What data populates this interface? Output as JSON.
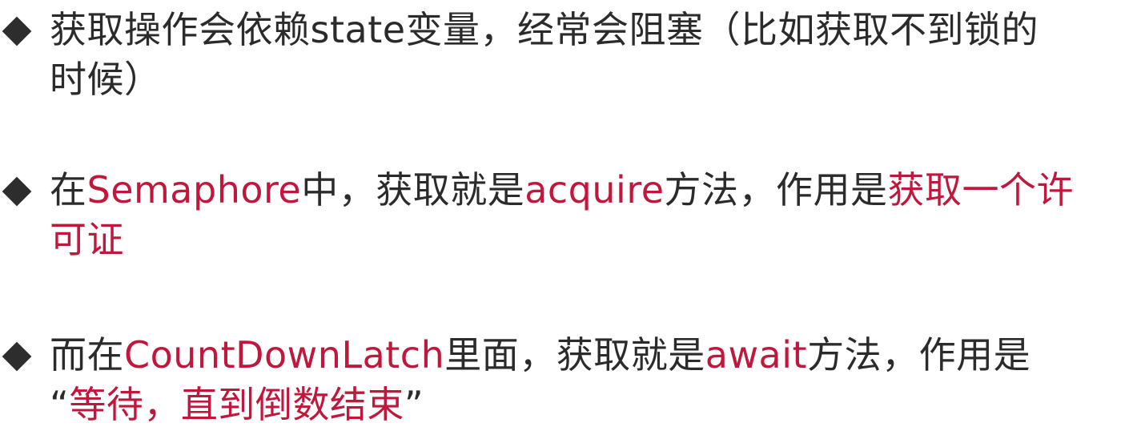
{
  "colors": {
    "text": "#2b2b2b",
    "highlight": "#c0183d",
    "bullet": "#2d2d2d"
  },
  "bullets": [
    {
      "icon": "diamond-bullet-icon",
      "line1": "获取操作会依赖state变量，经常会阻塞（比如获取不到锁的",
      "line2": "时候）"
    },
    {
      "icon": "diamond-bullet-icon",
      "t1": "在",
      "h1": "Semaphore",
      "t2": "中，获取就是",
      "h2": "acquire",
      "t3": "方法，作用是",
      "h3": "获取一个许",
      "h4": "可证"
    },
    {
      "icon": "diamond-bullet-icon",
      "t1": "而在",
      "h1": "CountDownLatch",
      "t2": "里面，获取就是",
      "h2": "await",
      "t3": "方法，作用是",
      "q_open": "“",
      "h3": "等待，直到倒数结束",
      "q_close": "”"
    }
  ]
}
